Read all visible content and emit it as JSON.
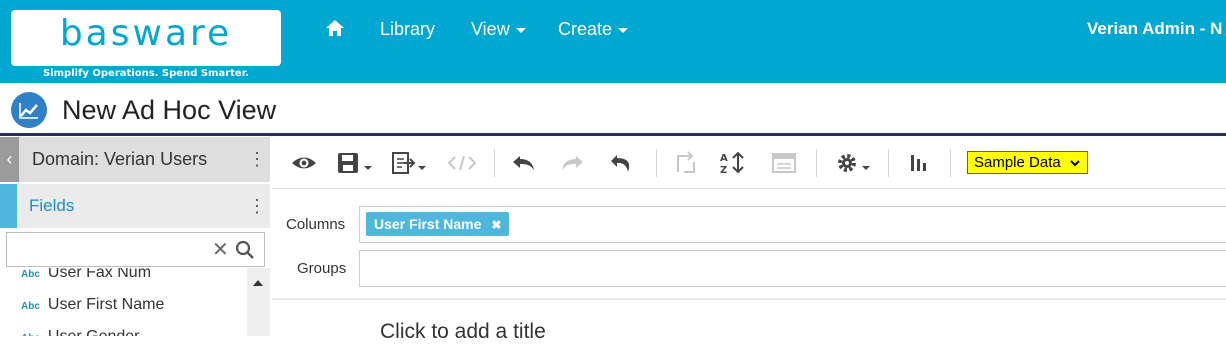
{
  "header": {
    "logo_text": "basware",
    "logo_tagline": "Simplify Operations. Spend Smarter.",
    "home_icon": "home-icon",
    "nav": {
      "library": "Library",
      "view": "View",
      "create": "Create"
    },
    "user": "Verian Admin - N"
  },
  "page": {
    "title": "New Ad Hoc View",
    "title_icon": "chart-line-icon"
  },
  "left_panel": {
    "domain_label": "Domain: Verian Users",
    "fields_label": "Fields",
    "search": {
      "value": "",
      "placeholder": ""
    },
    "fields": [
      {
        "type": "Abc",
        "label": "User Fax Num"
      },
      {
        "type": "Abc",
        "label": "User First Name"
      },
      {
        "type": "Abc",
        "label": "User Gender"
      }
    ]
  },
  "toolbar": {
    "icons": [
      "eye-icon",
      "save-icon",
      "export-icon",
      "code-icon",
      "undo-icon",
      "redo-icon",
      "undo-all-icon",
      "switch-group-icon",
      "sort-icon",
      "input-controls-icon",
      "gear-icon",
      "chart-bar-icon"
    ],
    "sample_data": "Sample Data"
  },
  "designer": {
    "columns_label": "Columns",
    "groups_label": "Groups",
    "column_chips": [
      "User First Name"
    ],
    "canvas_title_placeholder": "Click to add a title"
  },
  "colors": {
    "header_bg": "#00a7d0",
    "accent_blue": "#4fb6dc",
    "title_underline": "#24315e",
    "highlight": "#ffff00"
  }
}
